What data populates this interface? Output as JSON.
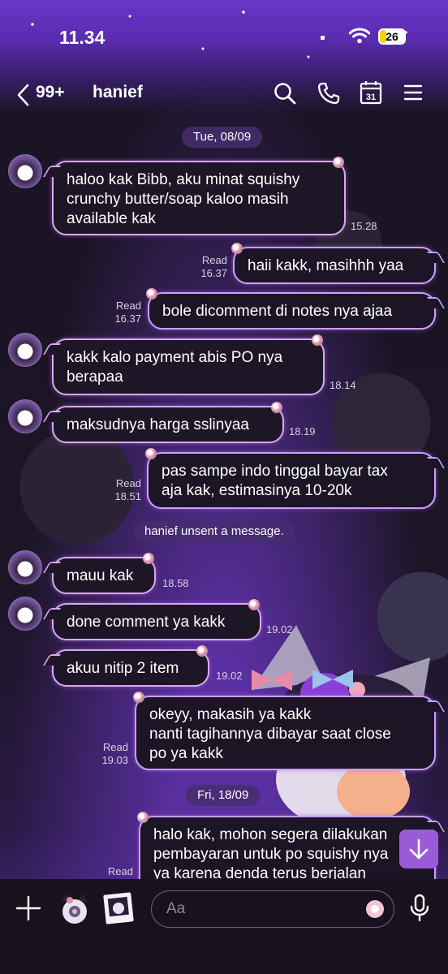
{
  "status_bar": {
    "time": "11.34",
    "battery": "26",
    "battery_fraction": 0.26
  },
  "header": {
    "back_count": "99+",
    "chat_name": "hanief"
  },
  "messages": [
    {
      "date": "Tue, 08/09"
    },
    {
      "lines": [
        "haloo kak Bibb, aku minat squishy",
        "crunchy butter/soap kaloo masih",
        "available kak"
      ],
      "time": "15.28"
    },
    {
      "lines": [
        "haii kakk, masihhh yaa"
      ],
      "read": "Read",
      "time": "16.37"
    },
    {
      "lines": [
        "bole dicomment di notes nya ajaa"
      ],
      "read": "Read",
      "time": "16.37"
    },
    {
      "lines": [
        "kakk kalo payment abis PO nya",
        "berapaa"
      ],
      "time": "18.14"
    },
    {
      "lines": [
        "maksudnya harga sslinyaa"
      ],
      "time": "18.19"
    },
    {
      "lines": [
        "pas sampe indo tinggal bayar tax",
        "aja kak, estimasinya 10-20k"
      ],
      "read": "Read",
      "time": "18.51"
    },
    {
      "system": "hanief unsent a message."
    },
    {
      "lines": [
        "mauu kak"
      ],
      "time": "18.58"
    },
    {
      "lines": [
        "done comment ya kakk"
      ],
      "time": "19.02"
    },
    {
      "lines": [
        "akuu nitip 2 item"
      ],
      "time": "19.02"
    },
    {
      "lines": [
        "okeyy, makasih ya kakk",
        "nanti tagihannya dibayar saat close",
        "po ya kakk"
      ],
      "read": "Read",
      "time": "19.03"
    },
    {
      "date": "Fri, 18/09"
    },
    {
      "lines": [
        "halo kak, mohon segera dilakukan",
        "pembayaran untuk po squishy nya",
        "ya karena denda terus berjalan"
      ],
      "read": "Read"
    }
  ],
  "input": {
    "placeholder": "Aa"
  },
  "colors": {
    "accent": "#9b5bd8",
    "bubble_border": "#d9a8f0"
  }
}
